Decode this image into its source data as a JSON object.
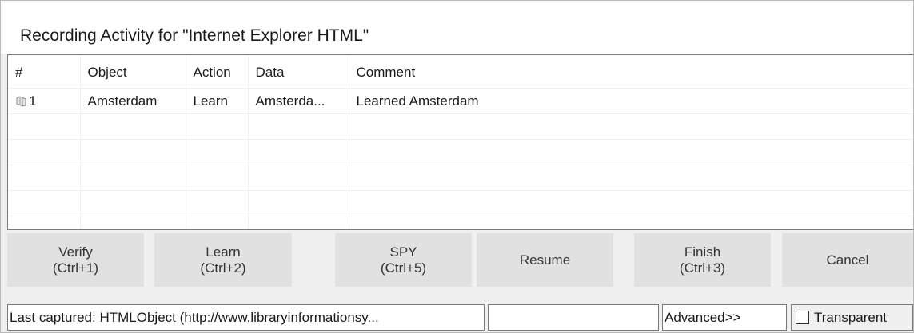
{
  "window": {
    "title": "Recording Activity for \"Internet Explorer HTML\""
  },
  "grid": {
    "columns": [
      "#",
      "Object",
      "Action",
      "Data",
      "Comment"
    ],
    "rows": [
      {
        "index": "1",
        "icon": "recording-row-icon",
        "object": "Amsterdam",
        "action": "Learn",
        "data": "Amsterda...",
        "comment": "Learned Amsterdam"
      }
    ]
  },
  "buttons": {
    "verify": {
      "line1": "Verify",
      "line2": "(Ctrl+1)"
    },
    "learn": {
      "line1": "Learn",
      "line2": "(Ctrl+2)"
    },
    "spy": {
      "line1": "SPY",
      "line2": "(Ctrl+5)"
    },
    "resume": {
      "line1": "Resume"
    },
    "finish": {
      "line1": "Finish",
      "line2": "(Ctrl+3)"
    },
    "cancel": {
      "line1": "Cancel"
    }
  },
  "status": {
    "last_captured": "Last  captured:  HTMLObject  (http://www.libraryinformationsy...",
    "extra_field": "",
    "advanced": "Advanced>>",
    "transparent_label": "Transparent",
    "transparent_checked": false
  }
}
